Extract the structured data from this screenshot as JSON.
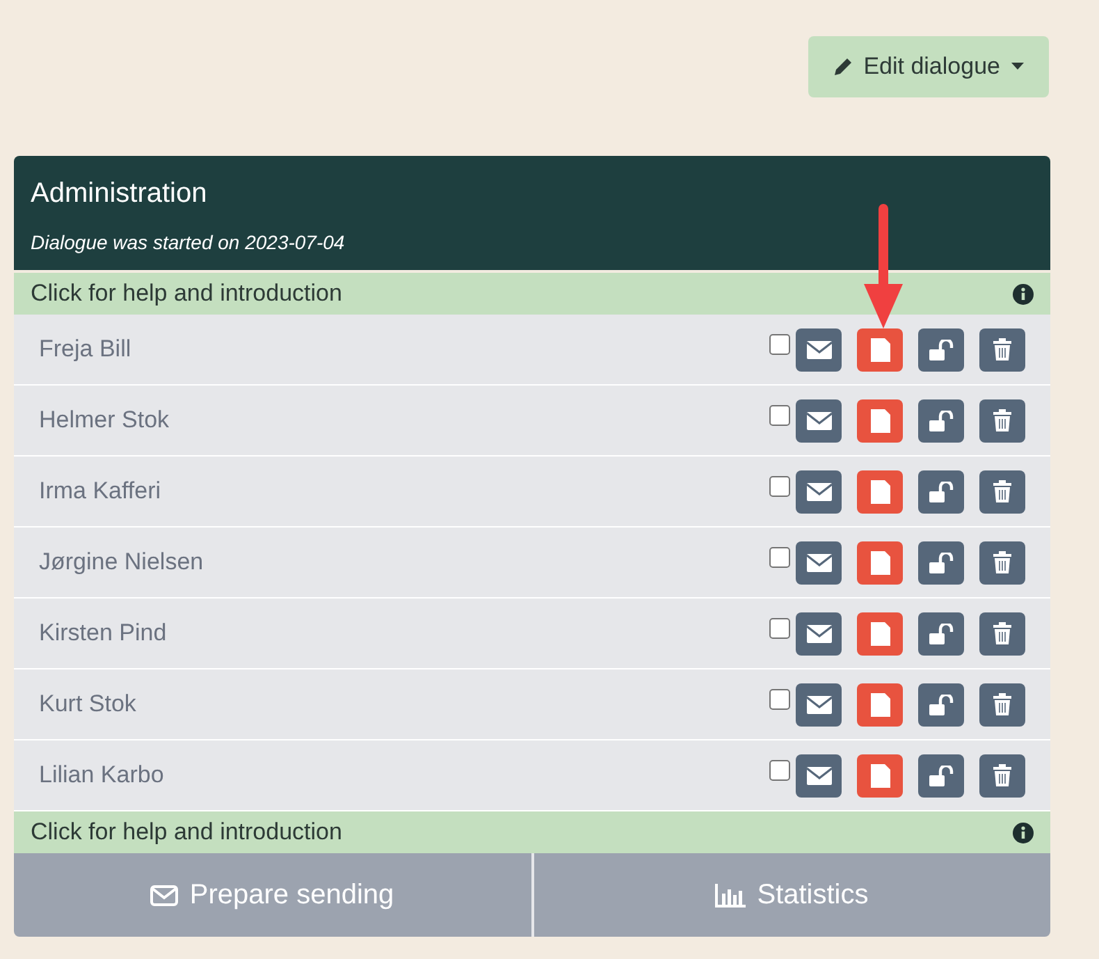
{
  "edit_button": {
    "label": "Edit dialogue"
  },
  "panel": {
    "title": "Administration",
    "subtitle": "Dialogue was started on 2023-07-04"
  },
  "help_bars": [
    {
      "label": "Click for help and introduction"
    },
    {
      "label": "Click for help and introduction"
    }
  ],
  "participants": [
    {
      "name": "Freja Bill",
      "checked": false
    },
    {
      "name": "Helmer Stok",
      "checked": false
    },
    {
      "name": "Irma Kafferi",
      "checked": false
    },
    {
      "name": "Jørgine Nielsen",
      "checked": false
    },
    {
      "name": "Kirsten Pind",
      "checked": false
    },
    {
      "name": "Kurt Stok",
      "checked": false
    },
    {
      "name": "Lilian Karbo",
      "checked": false
    }
  ],
  "footer_buttons": [
    {
      "kind": "send",
      "label": "Prepare sending"
    },
    {
      "kind": "stats",
      "label": "Statistics"
    }
  ]
}
